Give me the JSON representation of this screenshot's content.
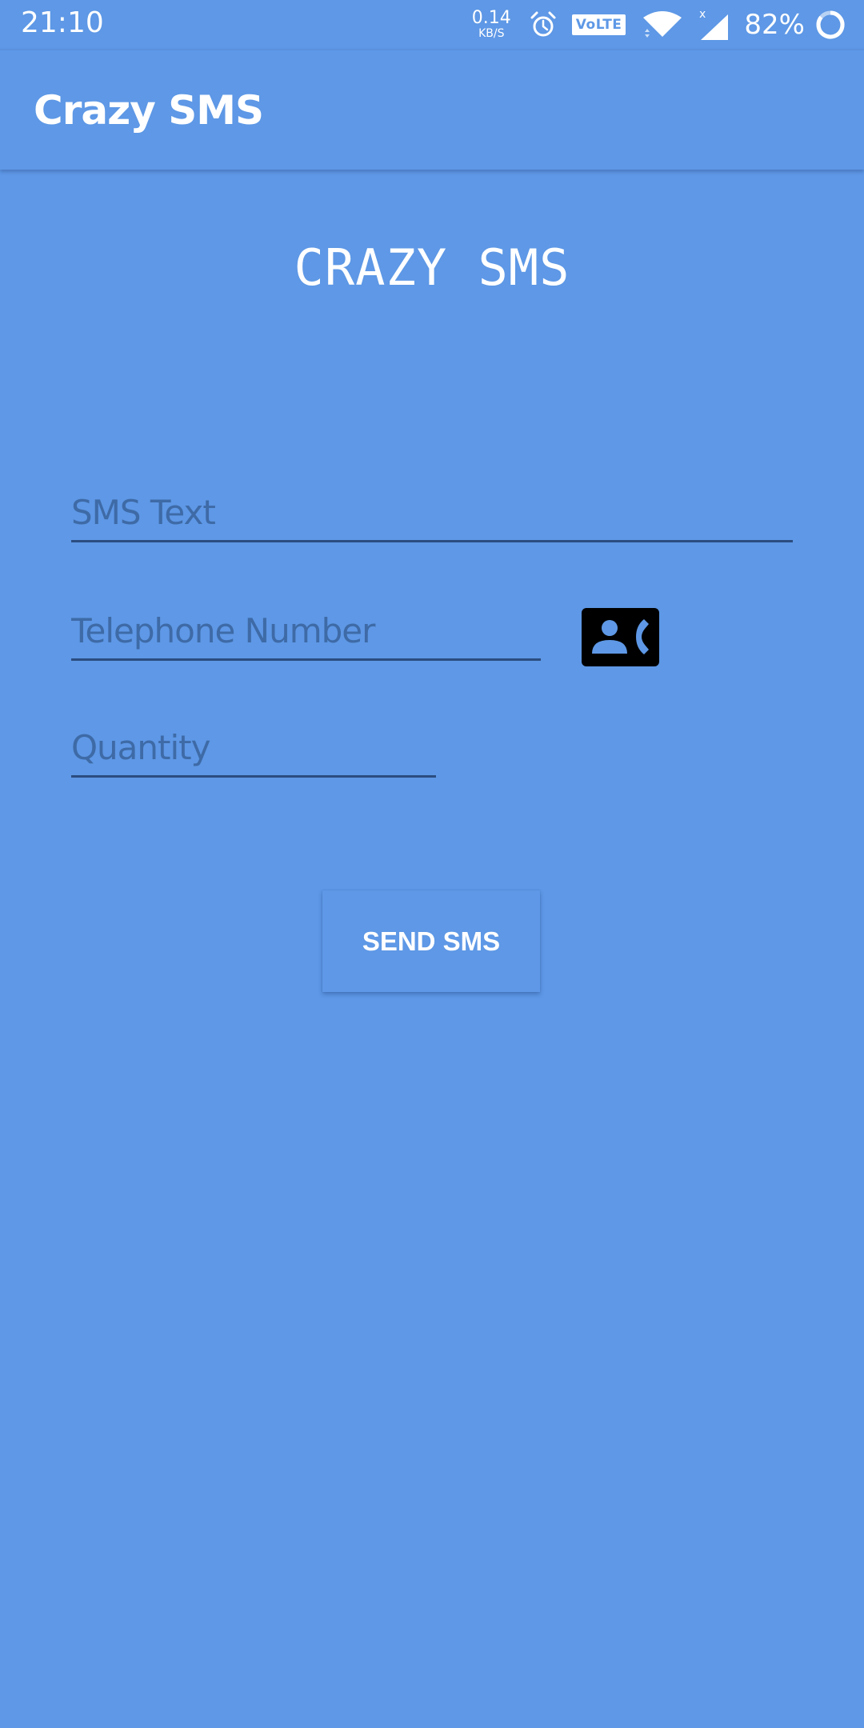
{
  "status_bar": {
    "time": "21:10",
    "net_speed_value": "0.14",
    "net_speed_unit": "KB/S",
    "volte_label": "VoLTE",
    "battery_percent": "82%",
    "icons": [
      "alarm-icon",
      "volte-icon",
      "wifi-icon",
      "signal-icon",
      "battery-icon"
    ]
  },
  "app_bar": {
    "title": "Crazy SMS"
  },
  "main": {
    "heading": "CRAZY SMS",
    "fields": {
      "sms_text": {
        "placeholder": "SMS Text",
        "value": ""
      },
      "telephone": {
        "placeholder": "Telephone Number",
        "value": ""
      },
      "quantity": {
        "placeholder": "Quantity",
        "value": ""
      }
    },
    "contact_picker_icon": "contact-phone-icon",
    "send_button_label": "SEND SMS"
  },
  "colors": {
    "background": "#5e98e6",
    "underline": "#2c4d80",
    "placeholder": "#3e6aa6",
    "text": "#ffffff"
  }
}
